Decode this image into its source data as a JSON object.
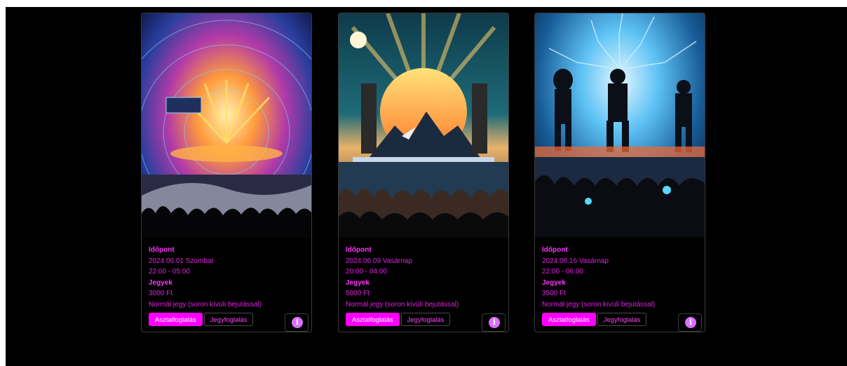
{
  "events": [
    {
      "image": "rock-festival-stage-crowd",
      "time_heading": "Időpont",
      "date": "2024.06.01 Szombat",
      "hours": "22:00 - 05:00",
      "tickets_heading": "Jegyek",
      "price": "3000 Ft",
      "ticket_type": "Normál jegy (soron kívüli bejutással)",
      "table_button": "Asztalfoglalás",
      "ticket_button": "Jegyfoglalás",
      "info_icon": "info-icon"
    },
    {
      "image": "sunset-mountain-concert-crowd",
      "time_heading": "Időpont",
      "date": "2024.06.09 Vasárnap",
      "hours": "20:00 - 04:00",
      "tickets_heading": "Jegyek",
      "price": "5000 Ft",
      "ticket_type": "Normál jegy (soron kívüli bejutással)",
      "table_button": "Asztalfoglalás",
      "ticket_button": "Jegyfoglalás",
      "info_icon": "info-icon"
    },
    {
      "image": "metal-band-lightning-crowd",
      "time_heading": "Időpont",
      "date": "2024.06.16 Vasárnap",
      "hours": "22:00 - 06:00",
      "tickets_heading": "Jegyek",
      "price": "3500 Ft",
      "ticket_type": "Normál jegy (soron kívüli bejutással)",
      "table_button": "Asztalfoglalás",
      "ticket_button": "Jegyfoglalás",
      "info_icon": "info-icon"
    }
  ],
  "colors": {
    "accent": "#ff00ff",
    "text": "#e61ee6",
    "background": "#000000",
    "info_icon": "#d970ff"
  }
}
